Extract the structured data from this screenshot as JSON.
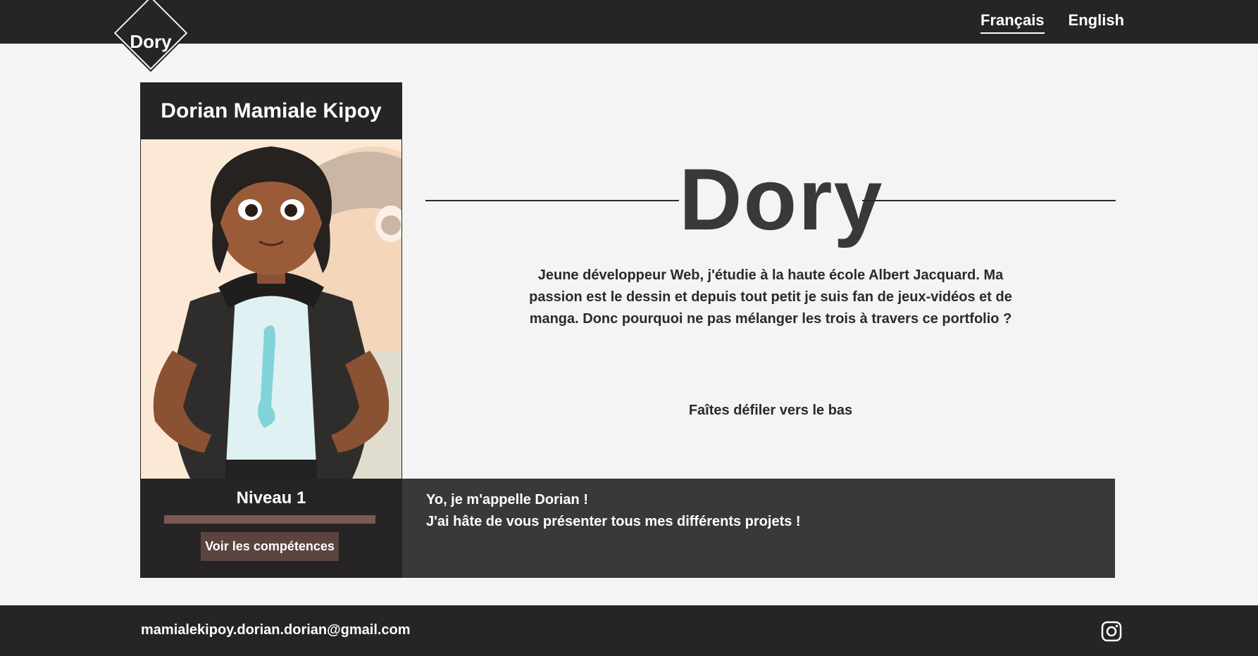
{
  "header": {
    "logo": "Dory",
    "languages": [
      {
        "label": "Français",
        "active": true
      },
      {
        "label": "English",
        "active": false
      }
    ]
  },
  "card": {
    "name": "Dorian Mamiale Kipoy",
    "level_label": "Niveau 1",
    "xp_progress": 1.0,
    "skills_button": "Voir les compétences"
  },
  "hero": {
    "title": "Dory",
    "description": "Jeune développeur Web, j'étudie à la haute école Albert Jacquard. Ma passion est le dessin et depuis tout petit je suis fan de jeux-vidéos et de manga. Donc pourquoi ne pas mélanger les trois à travers ce portfolio ?",
    "scroll_hint": "Faîtes défiler vers le bas"
  },
  "dialogue": {
    "line1": "Yo, je m'appelle Dorian !",
    "line2": "J'ai hâte de vous présenter tous mes différents projets !"
  },
  "footer": {
    "email": "mamialekipoy.dorian.dorian@gmail.com",
    "social_icon": "instagram-icon"
  },
  "colors": {
    "dark": "#262424",
    "dialogue_bg": "#3a3939",
    "accent_brown": "#5b4440",
    "page_bg": "#f4f4f4"
  }
}
